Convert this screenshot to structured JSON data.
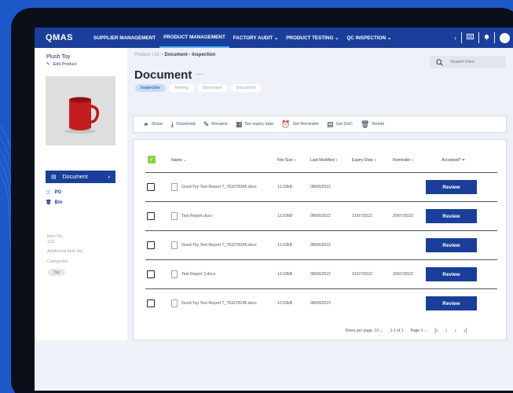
{
  "colors": {
    "primary": "#1a3f9a",
    "accent": "#4fb8ff",
    "check": "#8ed14a",
    "background": "#1d58c9"
  },
  "nav": {
    "logo": "QMAS",
    "items": [
      {
        "label": "SUPPLIER MANAGEMENT"
      },
      {
        "label": "PRODUCT MANAGEMENT"
      },
      {
        "label": "FACTORY AUDIT ⌄"
      },
      {
        "label": "PRODUCT TESTING ⌄"
      },
      {
        "label": "QC INSPECTION ⌄"
      }
    ],
    "icons": [
      "chevron-right-icon",
      "message-icon",
      "bell-icon"
    ]
  },
  "sidebar": {
    "product_name": "Plush Toy",
    "edit_label": "Edit Product",
    "document_label": "Document",
    "links": [
      {
        "label": "PO"
      },
      {
        "label": "Bin"
      }
    ],
    "item_no_label": "Item No.",
    "item_no_value": "123",
    "additional_item_label": "Additional Item No.",
    "categories_label": "Categories",
    "category_tag": "Toy"
  },
  "main": {
    "breadcrumb_root": "Product List",
    "breadcrumb_sep": ">",
    "breadcrumb_current": "Document - Inspection",
    "title": "Document",
    "title_menu": "···",
    "tabs": [
      {
        "label": "Inspection"
      },
      {
        "label": "Testing"
      },
      {
        "label": "Document"
      },
      {
        "label": "Document"
      }
    ],
    "active_tab": "Inspection",
    "search_placeholder": "Search Files"
  },
  "toolbar": [
    {
      "icon": "share-icon",
      "glyph": "⚭",
      "label": "Share"
    },
    {
      "icon": "download-icon",
      "glyph": "⤓",
      "label": "Download"
    },
    {
      "icon": "pencil-icon",
      "glyph": "✎",
      "label": "Rename"
    },
    {
      "icon": "calendar-icon",
      "glyph": "▦",
      "label": "Set expiry date"
    },
    {
      "icon": "alarm-icon",
      "glyph": "⏰",
      "label": "Set Reminder"
    },
    {
      "icon": "document-icon",
      "glyph": "▤",
      "label": "Get DoC"
    },
    {
      "icon": "trash-icon",
      "glyph": "🗑",
      "label": "Delete"
    }
  ],
  "table": {
    "headers": {
      "name": "Name ⌄",
      "size": "File Size ↕",
      "modified": "Last Modified ↕",
      "expiry": "Expiry Date ↕",
      "reminder": "Reminder ↕",
      "accepted": "Accepted? ⏷"
    },
    "rows": [
      {
        "name": "Good Toy Test Report T_763278245.docx",
        "size": "12.03kB",
        "modified": "08/06/2022",
        "expiry": "",
        "reminder": "",
        "action": "Review"
      },
      {
        "name": "Test Report.docx",
        "size": "12.03kB",
        "modified": "08/06/2022",
        "expiry": "31/07/2022",
        "reminder": "20/07/2022",
        "action": "Review"
      },
      {
        "name": "Good Toy Test Report T_763278245.docx",
        "size": "12.03kB",
        "modified": "08/06/2022",
        "expiry": "",
        "reminder": "",
        "action": "Review"
      },
      {
        "name": "Test Report 2.docx",
        "size": "12.03kB",
        "modified": "08/06/2022",
        "expiry": "31/07/2022",
        "reminder": "20/07/2022",
        "action": "Review"
      },
      {
        "name": "Good Toy Test Report T_763278245.docx",
        "size": "12.03kB",
        "modified": "08/06/2022",
        "expiry": "",
        "reminder": "",
        "action": "Review"
      }
    ],
    "pagination": {
      "rows_per_page": "Rows per page: 10 ⌄",
      "range": "1-1 of 1",
      "page": "Page 1 ⌄"
    }
  }
}
